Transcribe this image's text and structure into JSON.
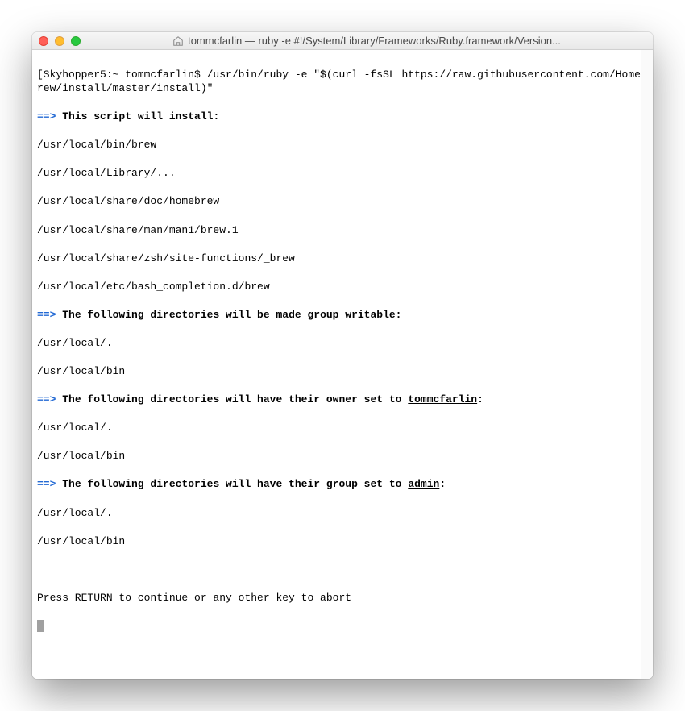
{
  "window": {
    "title": "tommcfarlin — ruby -e #!/System/Library/Frameworks/Ruby.framework/Version..."
  },
  "terminal": {
    "prompt_line": "[Skyhopper5:~ tommcfarlin$ /usr/bin/ruby -e \"$(curl -fsSL https://raw.githubusercontent.com/Homebrew/install/master/install)\"",
    "arrow": "==>",
    "section1_title": "This script will install:",
    "install_paths": [
      "/usr/local/bin/brew",
      "/usr/local/Library/...",
      "/usr/local/share/doc/homebrew",
      "/usr/local/share/man/man1/brew.1",
      "/usr/local/share/zsh/site-functions/_brew",
      "/usr/local/etc/bash_completion.d/brew"
    ],
    "section2_title": "The following directories will be made group writable:",
    "writable_paths": [
      "/usr/local/.",
      "/usr/local/bin"
    ],
    "section3_prefix": "The following directories will have their owner set to ",
    "section3_user": "tommcfarlin",
    "section3_suffix": ":",
    "owner_paths": [
      "/usr/local/.",
      "/usr/local/bin"
    ],
    "section4_prefix": "The following directories will have their group set to ",
    "section4_group": "admin",
    "section4_suffix": ":",
    "group_paths": [
      "/usr/local/.",
      "/usr/local/bin"
    ],
    "prompt_message": "Press RETURN to continue or any other key to abort"
  }
}
